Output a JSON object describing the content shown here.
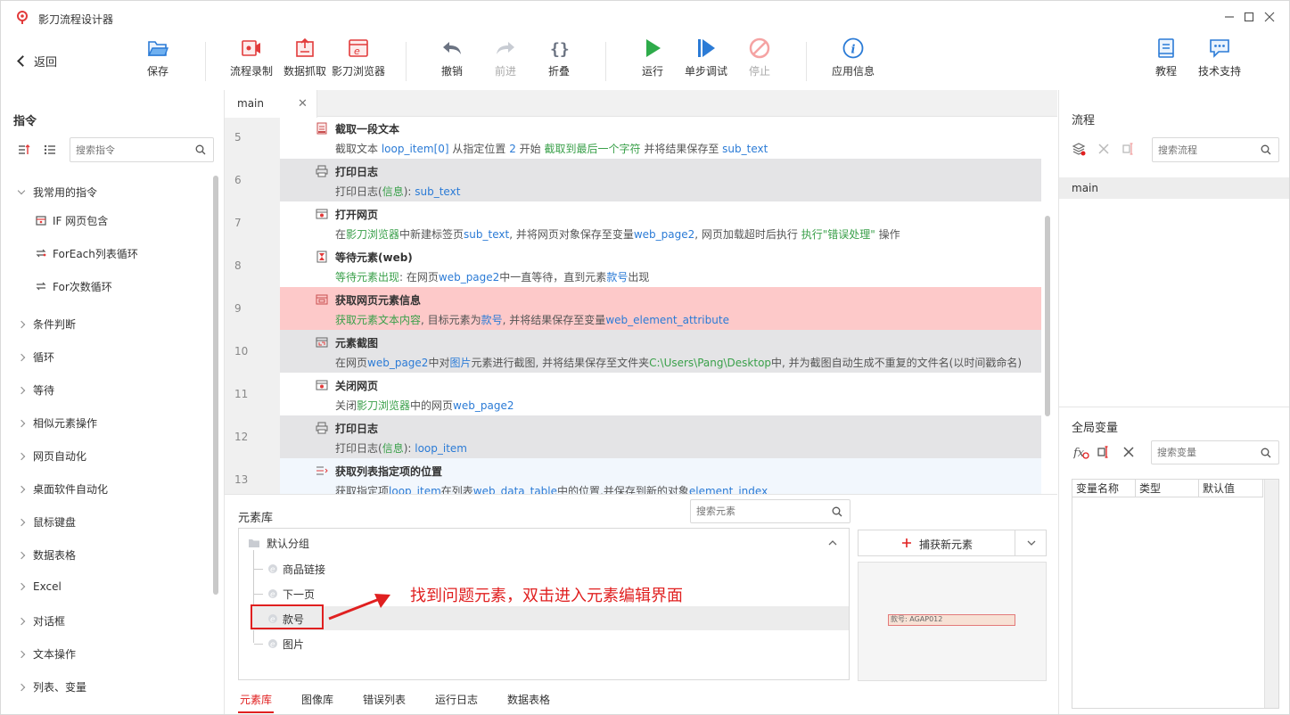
{
  "window": {
    "title": "影刀流程设计器"
  },
  "toolbar": {
    "back": "返回",
    "save": "保存",
    "record": "流程录制",
    "capture_data": "数据抓取",
    "browser": "影刀浏览器",
    "undo": "撤销",
    "redo": "前进",
    "fold": "折叠",
    "run": "运行",
    "step_debug": "单步调试",
    "stop": "停止",
    "app_info": "应用信息",
    "tutorial": "教程",
    "support": "技术支持"
  },
  "commands": {
    "title": "指令",
    "search_placeholder": "搜索指令",
    "favorites": {
      "label": "我常用的指令",
      "items": [
        "IF 网页包含",
        "ForEach列表循环",
        "For次数循环"
      ]
    },
    "categories": [
      "条件判断",
      "循环",
      "等待",
      "相似元素操作",
      "网页自动化",
      "桌面软件自动化",
      "鼠标键盘",
      "数据表格",
      "Excel",
      "对话框",
      "文本操作",
      "列表、变量"
    ]
  },
  "editor": {
    "tab": "main",
    "rows": [
      {
        "num": "5",
        "name": "截取一段文本",
        "style": "white",
        "icon": "text-cut-icon",
        "desc": [
          [
            "截取文本 ",
            ""
          ],
          [
            "loop_item[0]",
            "b"
          ],
          [
            " 从指定位置 ",
            ""
          ],
          [
            "2",
            "b"
          ],
          [
            " 开始 ",
            ""
          ],
          [
            "截取到最后一个字符",
            "g"
          ],
          [
            " 并将结果保存至 ",
            ""
          ],
          [
            "sub_text",
            "b"
          ]
        ]
      },
      {
        "num": "6",
        "name": "打印日志",
        "style": "gray",
        "icon": "print-icon",
        "desc": [
          [
            "打印日志(",
            ""
          ],
          [
            "信息",
            "g"
          ],
          [
            "): ",
            ""
          ],
          [
            "sub_text",
            "b"
          ]
        ]
      },
      {
        "num": "7",
        "name": "打开网页",
        "style": "white",
        "icon": "web-open-icon",
        "desc": [
          [
            "在",
            ""
          ],
          [
            "影刀浏览器",
            "g"
          ],
          [
            "中新建标签页",
            ""
          ],
          [
            "sub_text",
            "b"
          ],
          [
            ", 并将网页对象保存至变量",
            ""
          ],
          [
            "web_page2",
            "b"
          ],
          [
            ", 网页加载超时后执行 ",
            ""
          ],
          [
            "执行\"错误处理\"",
            "g"
          ],
          [
            " 操作",
            ""
          ]
        ]
      },
      {
        "num": "8",
        "name": "等待元素(web)",
        "style": "white",
        "icon": "hourglass-icon",
        "desc": [
          [
            "等待元素出现",
            "g"
          ],
          [
            ": 在网页",
            ""
          ],
          [
            "web_page2",
            "b"
          ],
          [
            "中一直等待，直到元素",
            ""
          ],
          [
            "款号",
            "b"
          ],
          [
            "出现",
            ""
          ]
        ]
      },
      {
        "num": "9",
        "name": "获取网页元素信息",
        "style": "red",
        "icon": "element-info-icon",
        "desc": [
          [
            "获取元素文本内容",
            "g"
          ],
          [
            ", 目标元素为",
            ""
          ],
          [
            "款号",
            "b"
          ],
          [
            ", 并将结果保存至变量",
            ""
          ],
          [
            "web_element_attribute",
            "b"
          ]
        ]
      },
      {
        "num": "10",
        "name": "元素截图",
        "style": "gray",
        "icon": "screenshot-icon",
        "desc": [
          [
            "在网页",
            ""
          ],
          [
            "web_page2",
            "b"
          ],
          [
            "中对",
            ""
          ],
          [
            "图片",
            "b"
          ],
          [
            "元素进行截图, 并将结果保存至文件夹",
            ""
          ],
          [
            "C:\\Users\\Pang\\Desktop",
            "g"
          ],
          [
            "中, 并为截图自动生成不重复的文件名(以时间戳命名)",
            ""
          ]
        ]
      },
      {
        "num": "11",
        "name": "关闭网页",
        "style": "white",
        "icon": "web-close-icon",
        "desc": [
          [
            "关闭",
            ""
          ],
          [
            "影刀浏览器",
            "g"
          ],
          [
            "中的网页",
            ""
          ],
          [
            "web_page2",
            "b"
          ]
        ]
      },
      {
        "num": "12",
        "name": "打印日志",
        "style": "gray",
        "icon": "print-icon",
        "desc": [
          [
            "打印日志(",
            ""
          ],
          [
            "信息",
            "g"
          ],
          [
            "): ",
            ""
          ],
          [
            "loop_item",
            "b"
          ]
        ]
      },
      {
        "num": "13",
        "name": "获取列表指定项的位置",
        "style": "blue",
        "icon": "list-index-icon",
        "desc": [
          [
            "获取指定项",
            ""
          ],
          [
            "loop_item",
            "b"
          ],
          [
            "在列表",
            ""
          ],
          [
            "web_data_table",
            "b"
          ],
          [
            "中的位置,并保存到新的对象",
            ""
          ],
          [
            "element_index",
            "b"
          ]
        ]
      }
    ]
  },
  "element_library": {
    "title": "元素库",
    "search_placeholder": "搜索元素",
    "group": "默认分组",
    "items": [
      "商品链接",
      "下一页",
      "款号",
      "图片"
    ],
    "capture_button": "捕获新元素",
    "preview_text": "款号: AGAP012",
    "tabs": [
      "元素库",
      "图像库",
      "错误列表",
      "运行日志",
      "数据表格"
    ]
  },
  "annotation": "找到问题元素，双击进入元素编辑界面",
  "flows": {
    "title": "流程",
    "search_placeholder": "搜索流程",
    "items": [
      "main"
    ]
  },
  "globals": {
    "title": "全局变量",
    "search_placeholder": "搜索变量",
    "columns": [
      "变量名称",
      "类型",
      "默认值"
    ]
  }
}
